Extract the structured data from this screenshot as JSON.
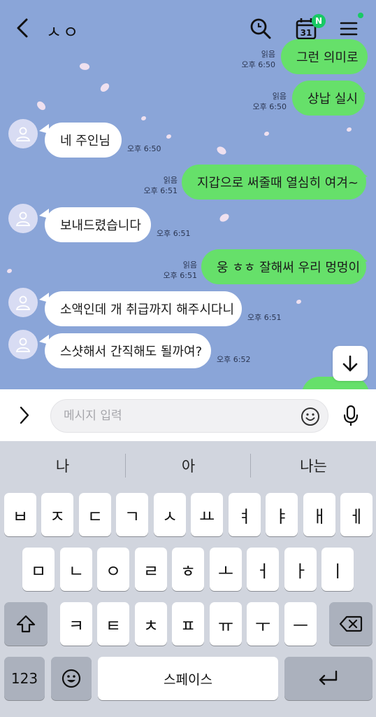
{
  "header": {
    "title": "ㅅㅇ",
    "calendar_date": "31",
    "calendar_badge": "N",
    "icons": [
      "back-chevron-icon",
      "search-icon",
      "calendar-icon",
      "menu-icon"
    ]
  },
  "messages": [
    {
      "side": "out",
      "text": "그런 의미로",
      "read": "읽음",
      "time": "오후 6:50"
    },
    {
      "side": "out",
      "text": "상납 실시",
      "read": "읽음",
      "time": "오후 6:50"
    },
    {
      "side": "in",
      "text": "네 주인님",
      "time": "오후 6:50"
    },
    {
      "side": "out",
      "text": "지갑으로 써줄때 열심히 여겨~",
      "read": "읽음",
      "time": "오후 6:51"
    },
    {
      "side": "in",
      "text": "보내드렸습니다",
      "time": "오후 6:51"
    },
    {
      "side": "out",
      "text": "웅 ㅎㅎ 잘해써 우리 멍멍이",
      "read": "읽음",
      "time": "오후 6:51"
    },
    {
      "side": "in",
      "text": "소액인데 개 취급까지 해주시다니",
      "time": "오후 6:51"
    },
    {
      "side": "in",
      "text": "스샷해서 간직해도 될까여?",
      "time": "오후 6:52"
    }
  ],
  "input": {
    "placeholder": "메시지 입력",
    "value": ""
  },
  "keyboard": {
    "suggestions": [
      "나",
      "아",
      "나는"
    ],
    "row1": [
      "ㅂ",
      "ㅈ",
      "ㄷ",
      "ㄱ",
      "ㅅ",
      "ㅛ",
      "ㅕ",
      "ㅑ",
      "ㅐ",
      "ㅔ"
    ],
    "row2": [
      "ㅁ",
      "ㄴ",
      "ㅇ",
      "ㄹ",
      "ㅎ",
      "ㅗ",
      "ㅓ",
      "ㅏ",
      "ㅣ"
    ],
    "row3": [
      "ㅋ",
      "ㅌ",
      "ㅊ",
      "ㅍ",
      "ㅠ",
      "ㅜ",
      "ㅡ"
    ],
    "numbers_label": "123",
    "space_label": "스페이스"
  },
  "colors": {
    "chat_background": "#8aa5d8",
    "outgoing_bubble": "#66e06a",
    "incoming_bubble": "#ffffff",
    "badge_green": "#18c964"
  }
}
